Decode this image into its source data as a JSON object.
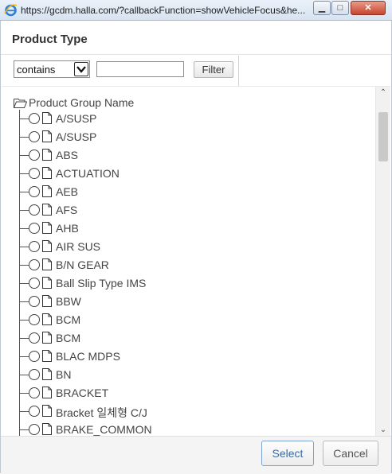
{
  "window": {
    "url": "https://gcdm.halla.com/?callbackFunction=showVehicleFocus&he...",
    "colors": {
      "titlebar": "#dbe6f3",
      "close": "#c7452c"
    }
  },
  "dialog": {
    "title": "Product Type",
    "filter": {
      "operator": "contains",
      "operator_options": [
        "contains"
      ],
      "value": "",
      "button_label": "Filter"
    },
    "tree": {
      "root_label": "Product Group Name",
      "items": [
        "A/SUSP",
        "A/SUSP",
        "ABS",
        "ACTUATION",
        "AEB",
        "AFS",
        "AHB",
        "AIR SUS",
        "B/N GEAR",
        "Ball Slip Type IMS",
        "BBW",
        "BCM",
        "BCM",
        "BLAC MDPS",
        "BN",
        "BRACKET",
        "Bracket 일체형 C/J",
        "BRAKE_COMMON"
      ]
    },
    "footer": {
      "select_label": "Select",
      "cancel_label": "Cancel"
    }
  }
}
